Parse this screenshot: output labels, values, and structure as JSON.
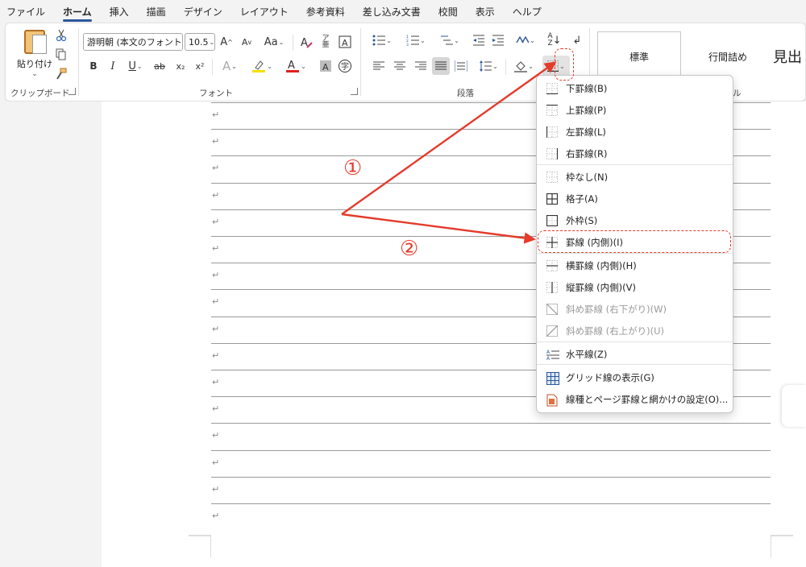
{
  "menubar": {
    "tabs": [
      "ファイル",
      "ホーム",
      "挿入",
      "描画",
      "デザイン",
      "レイアウト",
      "参考資料",
      "差し込み文書",
      "校閲",
      "表示",
      "ヘルプ"
    ],
    "active_index": 1
  },
  "ribbon": {
    "clipboard": {
      "paste_label": "貼り付け",
      "group_label": "クリップボード"
    },
    "font": {
      "font_name": "游明朝 (本文のフォント",
      "font_size": "10.5",
      "group_label": "フォント",
      "grow": "A",
      "shrink": "A",
      "case": "Aa",
      "bold": "B",
      "italic": "I",
      "underline": "U",
      "strike": "ab",
      "subscript": "x₂",
      "superscript": "x²",
      "effects": "A",
      "highlight_color": "#f5e000",
      "font_color": "#e02020"
    },
    "paragraph": {
      "group_label": "段落"
    },
    "styles": {
      "items": [
        "標準",
        "行間詰め",
        "見出"
      ],
      "group_label_partial": "ル"
    }
  },
  "document": {
    "paragraph_mark": "↵",
    "line_count": 16
  },
  "border_menu": {
    "items": [
      {
        "label": "下罫線(B)",
        "icon": "border-bottom-icon",
        "disabled": false
      },
      {
        "label": "上罫線(P)",
        "icon": "border-top-icon",
        "disabled": false
      },
      {
        "label": "左罫線(L)",
        "icon": "border-left-icon",
        "disabled": false
      },
      {
        "label": "右罫線(R)",
        "icon": "border-right-icon",
        "disabled": false
      },
      {
        "label": "枠なし(N)",
        "icon": "border-none-icon",
        "disabled": false
      },
      {
        "label": "格子(A)",
        "icon": "border-all-icon",
        "disabled": false
      },
      {
        "label": "外枠(S)",
        "icon": "border-outside-icon",
        "disabled": false
      },
      {
        "label": "罫線 (内側)(I)",
        "icon": "border-inside-icon",
        "disabled": false
      },
      {
        "label": "横罫線 (内側)(H)",
        "icon": "border-inside-horizontal-icon",
        "disabled": false
      },
      {
        "label": "縦罫線 (内側)(V)",
        "icon": "border-inside-vertical-icon",
        "disabled": false
      },
      {
        "label": "斜め罫線 (右下がり)(W)",
        "icon": "diagonal-down-border-icon",
        "disabled": true
      },
      {
        "label": "斜め罫線 (右上がり)(U)",
        "icon": "diagonal-up-border-icon",
        "disabled": true
      },
      {
        "label": "水平線(Z)",
        "icon": "horizontal-line-icon",
        "disabled": false
      },
      {
        "label": "グリッド線の表示(G)",
        "icon": "view-gridlines-icon",
        "disabled": false
      },
      {
        "label": "線種とページ罫線と網かけの設定(O)...",
        "icon": "borders-shading-icon",
        "disabled": false
      }
    ],
    "highlighted_index": 7
  },
  "annotations": {
    "step1": "①",
    "step2": "②",
    "color": "#e43b2b"
  }
}
